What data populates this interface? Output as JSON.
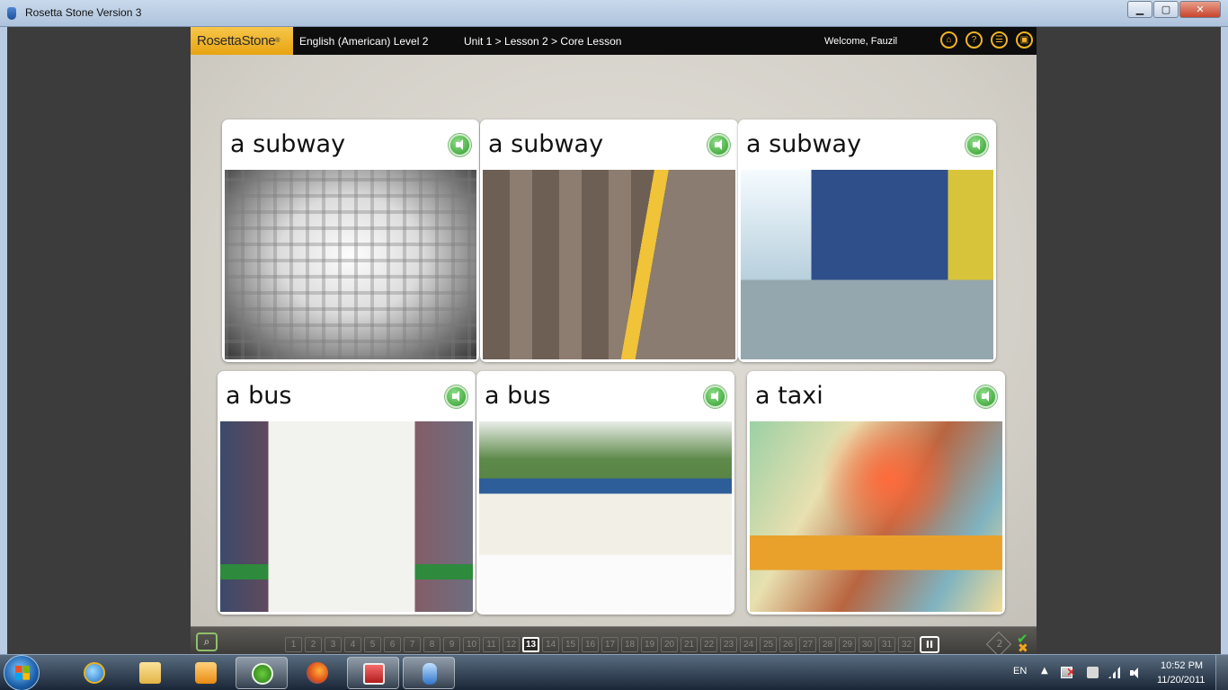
{
  "window": {
    "title": "Rosetta Stone Version 3",
    "minimize": "▁",
    "maximize": "▢",
    "close": "✕"
  },
  "header": {
    "logo": "RosettaStone",
    "logo_mark": "®",
    "course": "English (American) Level 2",
    "breadcrumb": "Unit 1 > Lesson 2 > Core Lesson",
    "welcome": "Welcome, Fauzil",
    "icons": [
      "home-icon",
      "help-icon",
      "menu-list-icon",
      "window-icon"
    ],
    "icon_glyphs": [
      "⌂",
      "?",
      "☰",
      "▣"
    ]
  },
  "cards": [
    {
      "label": "a subway",
      "photo": "subway-tunnel-photo"
    },
    {
      "label": "a subway",
      "photo": "subway-train-motion-photo"
    },
    {
      "label": "a subway",
      "photo": "subway-platform-photo"
    },
    {
      "label": "a bus",
      "photo": "double-decker-bus-photo"
    },
    {
      "label": "a bus",
      "photo": "trolley-bus-photo"
    },
    {
      "label": "a taxi",
      "photo": "taxi-motion-photo"
    }
  ],
  "nav": {
    "tool_glyph": "⌕",
    "screens": [
      "1",
      "2",
      "3",
      "4",
      "5",
      "6",
      "7",
      "8",
      "9",
      "10",
      "11",
      "12",
      "13",
      "14",
      "15",
      "16",
      "17",
      "18",
      "19",
      "20",
      "21",
      "22",
      "23",
      "24",
      "25",
      "26",
      "27",
      "28",
      "29",
      "30",
      "31",
      "32"
    ],
    "current_screen": "13",
    "pause_glyph": "II",
    "attempts": "2",
    "check_glyph": "✔",
    "x_glyph": "✖"
  },
  "taskbar": {
    "apps": [
      "internet-explorer",
      "windows-explorer",
      "media-center",
      "utorrent",
      "firefox",
      "acrobat",
      "rosetta-stone"
    ],
    "language": "EN",
    "tray_arrow": "▲",
    "time": "10:52 PM",
    "date": "11/20/2011"
  },
  "colors": {
    "brand_yellow": "#f0b323",
    "speaker_green": "#2f9a2a",
    "check_green": "#38c93b",
    "x_orange": "#f0a61c"
  }
}
